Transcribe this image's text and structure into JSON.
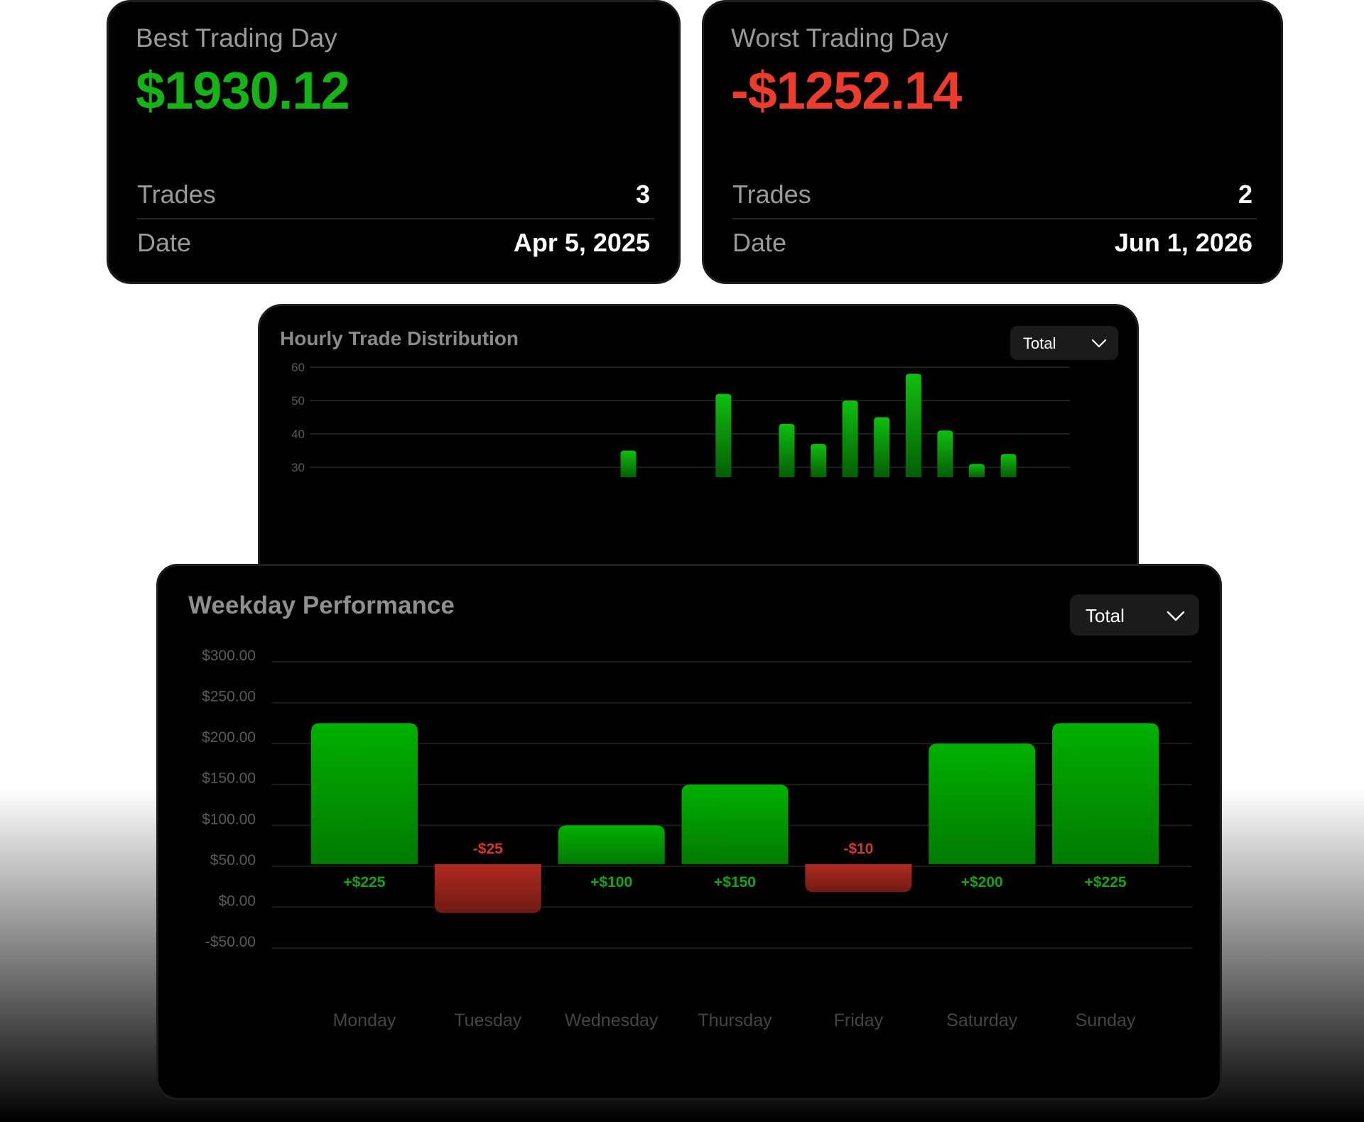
{
  "best_day": {
    "title": "Best Trading Day",
    "value": "$1930.12",
    "trades_label": "Trades",
    "trades_value": "3",
    "date_label": "Date",
    "date_value": "Apr 5, 2025"
  },
  "worst_day": {
    "title": "Worst Trading Day",
    "value": "-$1252.14",
    "trades_label": "Trades",
    "trades_value": "2",
    "date_label": "Date",
    "date_value": "Jun 1, 2026"
  },
  "colors": {
    "positive": "#14b414",
    "negative": "#ee3c2c",
    "bar_green": "#00aa00",
    "bar_red": "#a8281f"
  },
  "hourly": {
    "title": "Hourly Trade Distribution",
    "dropdown_label": "Total",
    "dropdown_icon": "chevron-down-icon"
  },
  "weekday": {
    "title": "Weekday Performance",
    "dropdown_label": "Total",
    "dropdown_icon": "chevron-down-icon"
  },
  "chart_data": [
    {
      "type": "bar",
      "title": "Hourly Trade Distribution",
      "y_ticks": [
        "60",
        "50",
        "40",
        "30"
      ],
      "ylim": [
        30,
        60
      ],
      "visible_y_range": [
        27,
        62
      ],
      "bars": [
        {
          "slot": 9,
          "value": 35
        },
        {
          "slot": 12,
          "value": 52
        },
        {
          "slot": 14,
          "value": 43
        },
        {
          "slot": 15,
          "value": 37
        },
        {
          "slot": 16,
          "value": 50
        },
        {
          "slot": 17,
          "value": 45
        },
        {
          "slot": 18,
          "value": 58
        },
        {
          "slot": 19,
          "value": 41
        },
        {
          "slot": 20,
          "value": 31
        },
        {
          "slot": 21,
          "value": 34
        }
      ],
      "slot_count": 24,
      "grid": true
    },
    {
      "type": "bar",
      "title": "Weekday Performance",
      "categories": [
        "Monday",
        "Tuesday",
        "Wednesday",
        "Thursday",
        "Friday",
        "Saturday",
        "Sunday"
      ],
      "values": [
        225,
        -25,
        100,
        150,
        -10,
        200,
        225
      ],
      "data_labels": [
        "+$225",
        "-$25",
        "+$100",
        "+$150",
        "-$10",
        "+$200",
        "+$225"
      ],
      "y_ticks": [
        "$300.00",
        "$250.00",
        "$200.00",
        "$150.00",
        "$100.00",
        "$50.00",
        "$0.00",
        "-$50.00"
      ],
      "ylim": [
        -50,
        300
      ],
      "grid": true
    }
  ]
}
